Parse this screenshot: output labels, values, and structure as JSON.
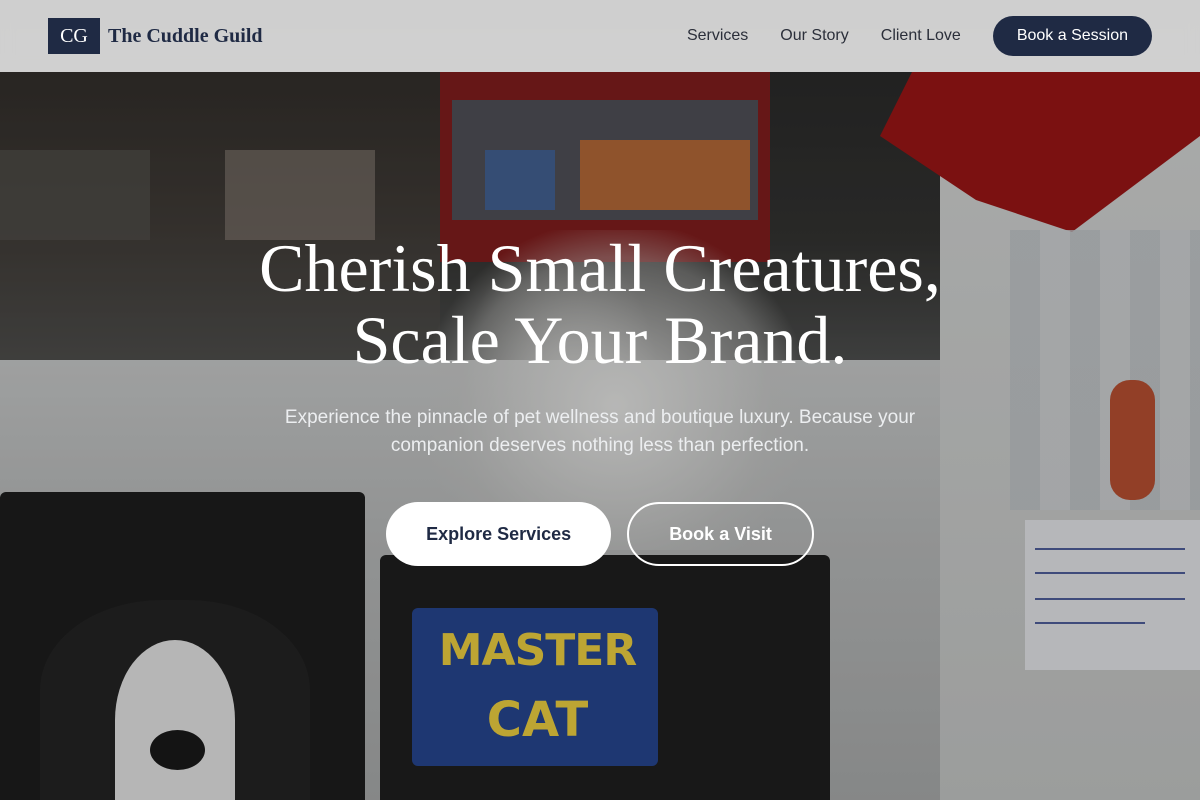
{
  "nav": {
    "logo_mark": "CG",
    "brand_name": "The Cuddle Guild",
    "links": [
      "Services",
      "Our Story",
      "Client Love"
    ],
    "cta_label": "Book a Session"
  },
  "hero": {
    "title_line1": "Cherish Small Creatures,",
    "title_line2": "Scale Your Brand.",
    "subtitle": "Experience the pinnacle of pet wellness and boutique luxury. Because your companion deserves nothing less than perfection.",
    "primary_button": "Explore Services",
    "secondary_button": "Book a Visit",
    "background_label_1": "MASTER",
    "background_label_2": "CAT"
  },
  "colors": {
    "brand_navy": "#1f2a44",
    "nav_background": "#e8e8e8",
    "text_white": "#ffffff"
  }
}
